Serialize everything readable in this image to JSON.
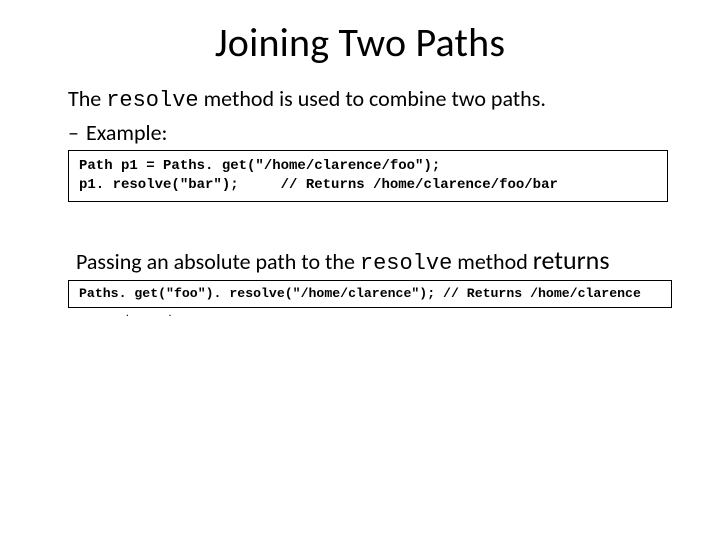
{
  "title": "Joining Two Paths",
  "intro": {
    "pre": "The ",
    "code": "resolve",
    "post": " method is used to combine two paths."
  },
  "bullet": {
    "dash": "–",
    "label": "Example:"
  },
  "code1": {
    "line1": "Path p1 = Paths. get(\"/home/clarence/foo\");",
    "line2": "p1. resolve(\"bar\");     // Returns /home/clarence/foo/bar"
  },
  "para2": {
    "pre": "Passing an absolute path to the ",
    "code": "resolve",
    "mid": " method ",
    "tail": "returns"
  },
  "code2": {
    "line1": "Paths. get(\"foo\"). resolve(\"/home/clarence\"); // Returns /home/clarence"
  },
  "under": {
    "dot1": ".",
    "dot2": "."
  }
}
